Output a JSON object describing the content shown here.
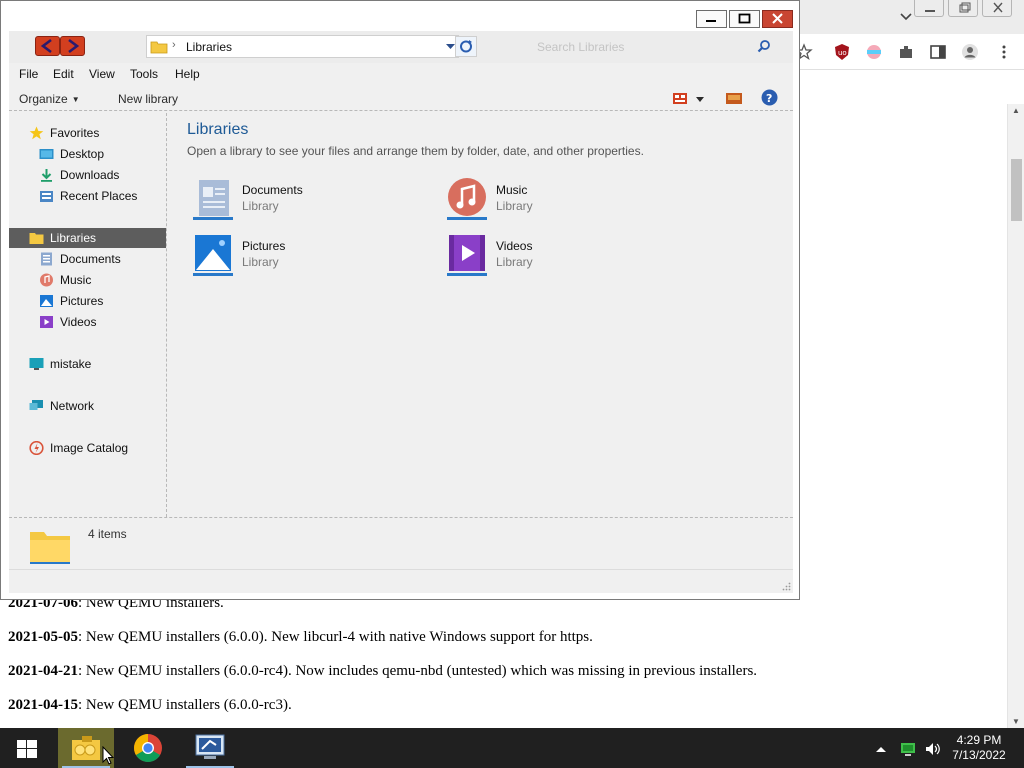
{
  "explorer": {
    "title_buttons": {
      "minimize": "—",
      "maximize": "☐",
      "close": "✕"
    },
    "address": {
      "path": "Libraries"
    },
    "search": {
      "placeholder": "Search Libraries"
    },
    "menu": [
      "File",
      "Edit",
      "View",
      "Tools",
      "Help"
    ],
    "command_bar": {
      "organize": "Organize",
      "new_library": "New library"
    },
    "nav_pane": {
      "favorites": {
        "label": "Favorites",
        "items": [
          "Desktop",
          "Downloads",
          "Recent Places"
        ]
      },
      "libraries": {
        "label": "Libraries",
        "items": [
          "Documents",
          "Music",
          "Pictures",
          "Videos"
        ]
      },
      "computer": "mistake",
      "network": "Network",
      "image_catalog": "Image Catalog"
    },
    "content": {
      "heading": "Libraries",
      "subheading": "Open a library to see your files and arrange them by folder, date, and other properties.",
      "libraries": [
        {
          "name": "Documents",
          "kind": "Library",
          "icon": "documents-library-icon"
        },
        {
          "name": "Music",
          "kind": "Library",
          "icon": "music-library-icon"
        },
        {
          "name": "Pictures",
          "kind": "Library",
          "icon": "pictures-library-icon"
        },
        {
          "name": "Videos",
          "kind": "Library",
          "icon": "videos-library-icon"
        }
      ]
    },
    "details": {
      "item_count": "4 items"
    }
  },
  "browser_page": {
    "news": [
      {
        "date": "2021-07-06",
        "text": ": New QEMU installers."
      },
      {
        "date": "2021-05-05",
        "text": ": New QEMU installers (6.0.0). New libcurl-4 with native Windows support for https."
      },
      {
        "date": "2021-04-21",
        "text": ": New QEMU installers (6.0.0-rc4). Now includes qemu-nbd (untested) which was missing in previous installers."
      },
      {
        "date": "2021-04-15",
        "text": ": New QEMU installers (6.0.0-rc3)."
      }
    ]
  },
  "taskbar": {
    "time": "4:29 PM",
    "date": "7/13/2022",
    "apps": [
      "file-explorer-icon",
      "chrome-icon",
      "remote-desktop-icon"
    ]
  },
  "colors": {
    "accent_blue": "#1e5a96",
    "selected_nav": "#5d5d5d",
    "close_red": "#c94532",
    "taskbar": "#202020"
  }
}
